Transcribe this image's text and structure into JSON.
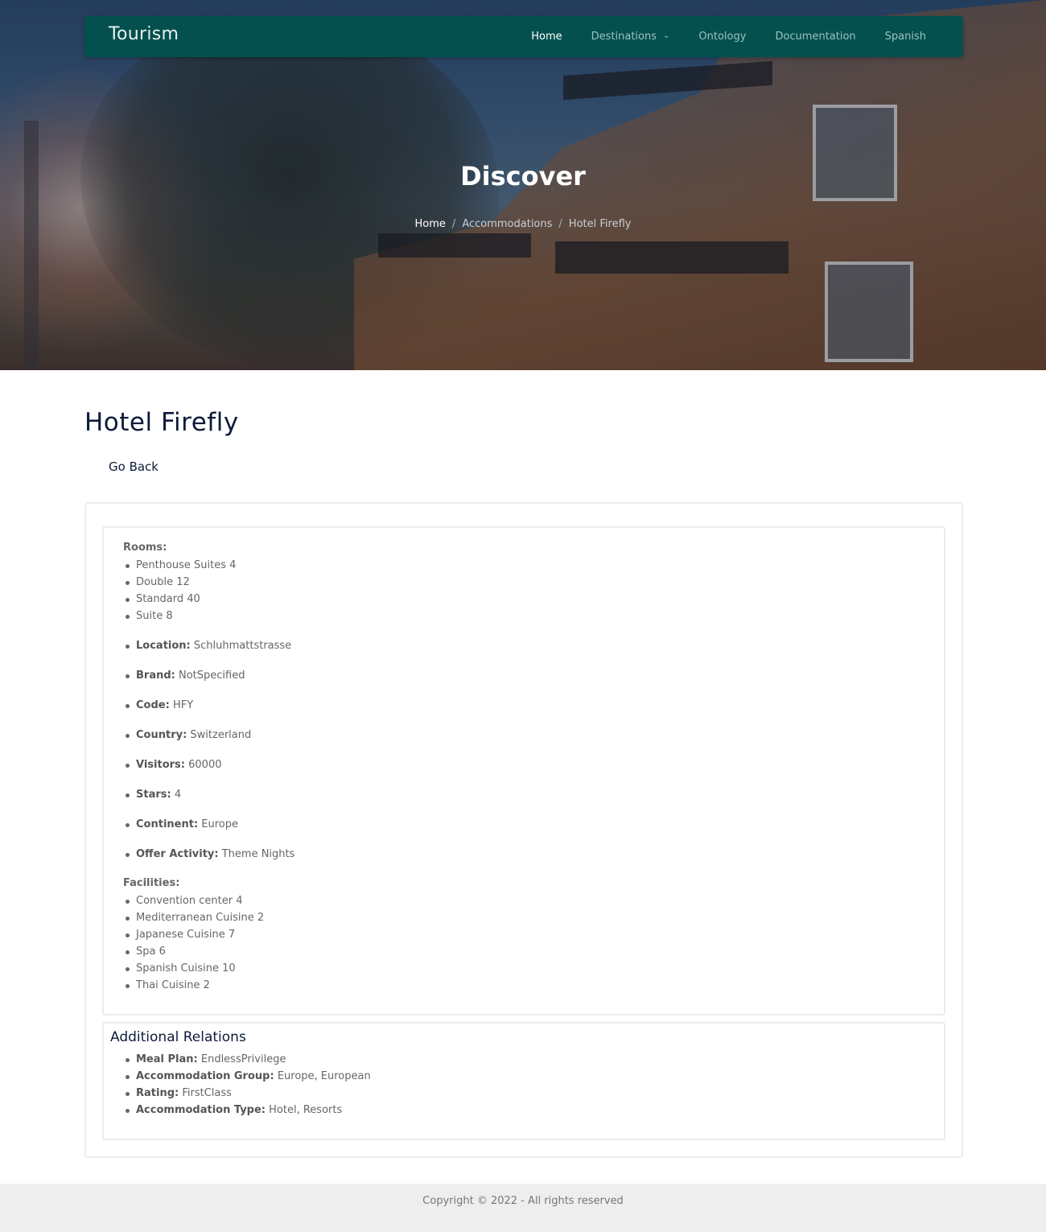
{
  "nav": {
    "brand": "Tourism",
    "links": [
      "Home",
      "Destinations",
      "Ontology",
      "Documentation",
      "Spanish"
    ]
  },
  "hero": {
    "title": "Discover",
    "breadcrumb": [
      "Home",
      "Accommodations",
      "Hotel Firefly"
    ],
    "separator": "/"
  },
  "main": {
    "title": "Hotel Firefly",
    "go_back": "Go Back"
  },
  "details": {
    "rooms_label": "Rooms:",
    "rooms": [
      "Penthouse Suites 4",
      "Double 12",
      "Standard 40",
      "Suite 8"
    ],
    "properties": [
      {
        "label": "Location:",
        "value": "Schluhmattstrasse"
      },
      {
        "label": "Brand:",
        "value": "NotSpecified"
      },
      {
        "label": "Code:",
        "value": "HFY"
      },
      {
        "label": "Country:",
        "value": "Switzerland"
      },
      {
        "label": "Visitors:",
        "value": "60000"
      },
      {
        "label": "Stars:",
        "value": "4"
      },
      {
        "label": "Continent:",
        "value": "Europe"
      },
      {
        "label": "Offer Activity:",
        "value": "Theme Nights"
      }
    ],
    "facilities_label": "Facilities:",
    "facilities": [
      "Convention center 4",
      "Mediterranean Cuisine 2",
      "Japanese Cuisine 7",
      "Spa 6",
      "Spanish Cuisine 10",
      "Thai Cuisine 2"
    ]
  },
  "relations": {
    "title": "Additional Relations",
    "items": [
      {
        "label": "Meal Plan:",
        "value": "EndlessPrivilege"
      },
      {
        "label": "Accommodation Group:",
        "value": "Europe, European"
      },
      {
        "label": "Rating:",
        "value": "FirstClass"
      },
      {
        "label": "Accommodation Type:",
        "value": "Hotel, Resorts"
      }
    ]
  },
  "footer": {
    "text": "Copyright © 2022 - All rights reserved"
  }
}
